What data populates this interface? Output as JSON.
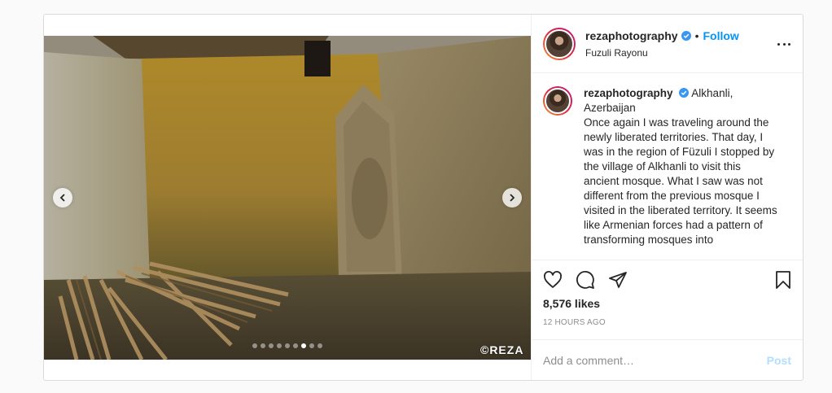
{
  "post": {
    "username": "rezaphotography",
    "follow_label": "Follow",
    "separator": "•",
    "location": "Fuzuli Rayonu",
    "watermark": "©REZA",
    "caption_location": "Alkhanli, Azerbaijan",
    "caption_text": "Once again I was traveling around the newly liberated territories. That day, I was in the region of Füzuli I stopped by the village of Alkhanli to visit this ancient mosque. What I saw was not different from the previous mosque I visited in the liberated territory. It seems like Armenian forces had a pattern of transforming mosques into",
    "likes": "8,576 likes",
    "timestamp": "12 HOURS AGO",
    "comment_placeholder": "Add a comment…",
    "post_label": "Post",
    "carousel_dots": 9,
    "carousel_active": 6
  },
  "icons": {
    "verified": "verified-badge-icon",
    "more": "more-options-icon",
    "like": "heart-icon",
    "comment": "comment-icon",
    "share": "share-icon",
    "save": "bookmark-icon",
    "prev": "chevron-left-icon",
    "next": "chevron-right-icon"
  },
  "colors": {
    "accent": "#0095f6",
    "post_disabled": "#b2dffc",
    "muted": "#8e8e8e"
  }
}
